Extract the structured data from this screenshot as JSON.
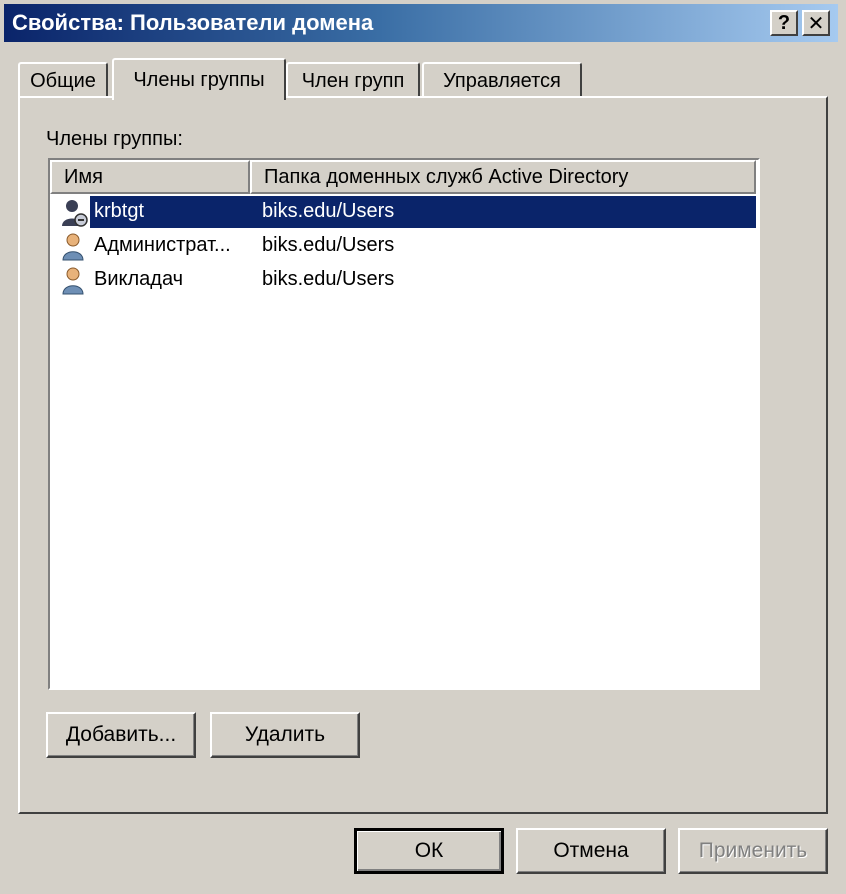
{
  "window": {
    "title": "Свойства: Пользователи домена",
    "help_label": "?",
    "close_label": "✕"
  },
  "tabs": [
    {
      "label": "Общие",
      "active": false
    },
    {
      "label": "Члены группы",
      "active": true
    },
    {
      "label": "Член групп",
      "active": false
    },
    {
      "label": "Управляется",
      "active": false
    }
  ],
  "members": {
    "label": "Члены группы:",
    "columns": [
      "Имя",
      "Папка доменных служб Active Directory"
    ],
    "rows": [
      {
        "name": "krbtgt",
        "folder": "biks.edu/Users",
        "icon": "disabled-user-icon",
        "selected": true
      },
      {
        "name": "Администрат...",
        "folder": "biks.edu/Users",
        "icon": "user-icon",
        "selected": false
      },
      {
        "name": "Викладач",
        "folder": "biks.edu/Users",
        "icon": "user-icon",
        "selected": false
      }
    ]
  },
  "buttons": {
    "add": "Добавить...",
    "remove": "Удалить",
    "ok": "ОК",
    "cancel": "Отмена",
    "apply": "Применить"
  },
  "colors": {
    "title_gradient_start": "#0a246a",
    "title_gradient_end": "#a6caf0",
    "selection": "#0a246a",
    "face": "#d4d0c8"
  }
}
